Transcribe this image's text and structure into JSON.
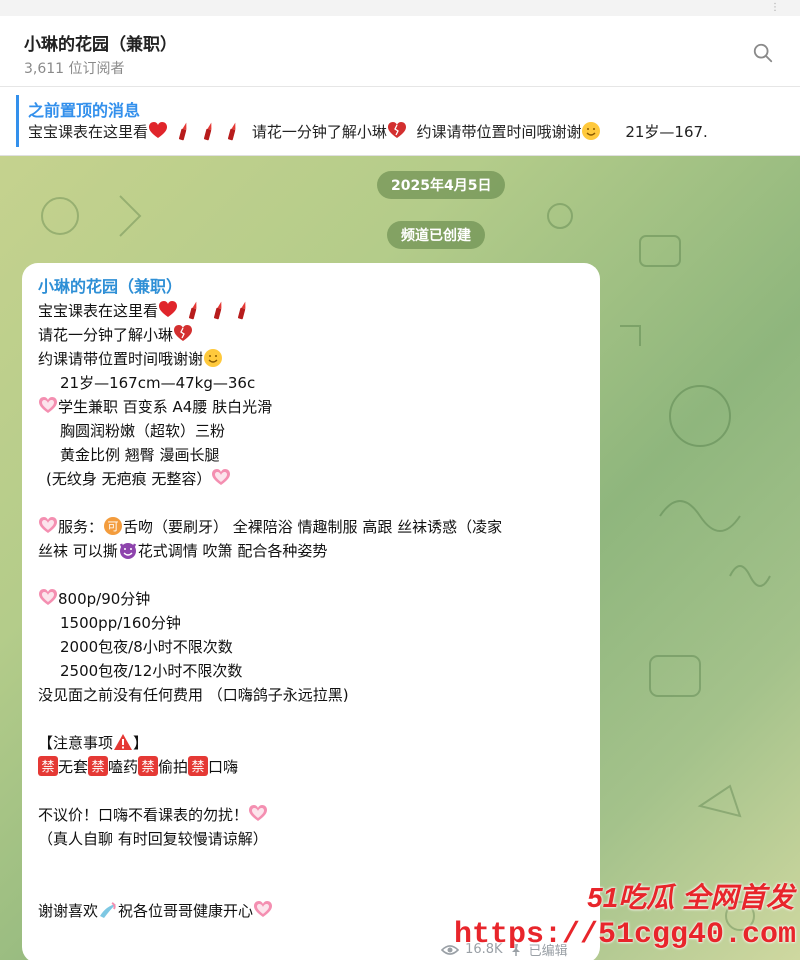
{
  "channel": {
    "name": "小琳的花园（兼职）",
    "subscribers": "3,611 位订阅者"
  },
  "pinned": {
    "label": "之前置顶的消息",
    "text_a": "宝宝课表在这里看",
    "text_b": "请花一分钟了解小琳",
    "text_c": "约课请带位置时间哦谢谢",
    "text_d": "21岁—167."
  },
  "chat": {
    "date_pill": "2025年4月5日",
    "service_pill": "频道已创建"
  },
  "message": {
    "sender": "小琳的花园（兼职）",
    "l01": "宝宝课表在这里看",
    "l02": "请花一分钟了解小琳",
    "l03": "约课请带位置时间哦谢谢",
    "l04": "21岁—167cm—47kg—36c",
    "l05": "学生兼职 百变系 A4腰 肤白光滑",
    "l06": "胸圆润粉嫩（超软）三粉",
    "l07": "黄金比例 翘臀 漫画长腿",
    "l08": "(无纹身 无疤痕 无整容）",
    "l09a": "服务：",
    "l09b": "舌吻（要刷牙） 全裸陪浴 情趣制服 高跟 丝袜诱惑（凌家",
    "l10a": "丝袜 可以撕",
    "l10b": "花式调情 吹箫 配合各种姿势",
    "l11": "800p/90分钟",
    "l12": "1500pp/160分钟",
    "l13": "2000包夜/8小时不限次数",
    "l14": "2500包夜/12小时不限次数",
    "l15": "没见面之前没有任何费用 （口嗨鸽子永远拉黑)",
    "l16": "【注意事项",
    "l16b": "】",
    "ban": "禁",
    "l17a": "无套",
    "l17b": "嗑药",
    "l17c": "偷拍",
    "l17d": "口嗨",
    "l18": "不议价！口嗨不看课表的勿扰！",
    "l19": "（真人自聊 有时回复较慢请谅解）",
    "l20a": "谢谢喜欢",
    "l20b": "祝各位哥哥健康开心",
    "views": "16.8K",
    "edited": "已编辑",
    "time": "   "
  },
  "watermark": {
    "line1": "51吃瓜 全网首发",
    "line2": "https://51cgg40.com"
  },
  "icons": [
    "search-icon",
    "heart-icon",
    "lipstick-icon",
    "broken-heart-icon",
    "smiling-face-icon",
    "heart-decoration-icon",
    "warning-icon",
    "devil-icon",
    "eye-icon",
    "pin-icon"
  ]
}
